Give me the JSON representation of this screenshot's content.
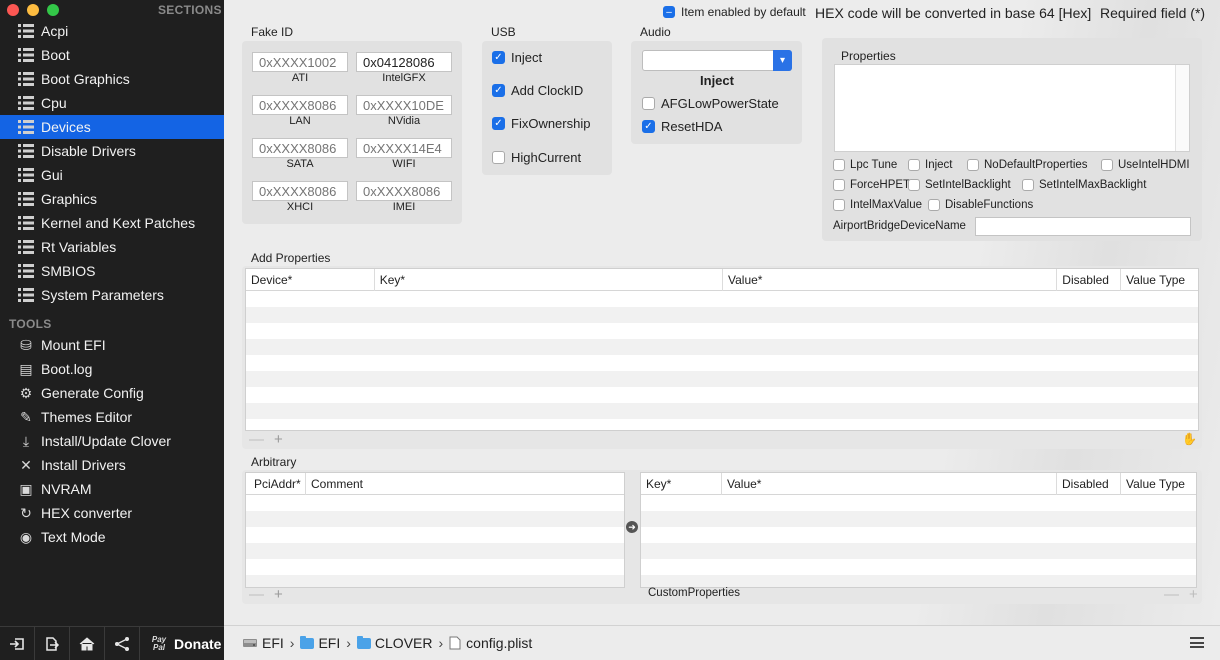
{
  "window": {
    "traffic_colors": [
      "#fc5753",
      "#fdbc40",
      "#33c748"
    ]
  },
  "sidebar": {
    "sections_heading": "SECTIONS",
    "sections": [
      {
        "label": "Acpi",
        "icon": "list-grid-icon"
      },
      {
        "label": "Boot",
        "icon": "list-grid-icon"
      },
      {
        "label": "Boot Graphics",
        "icon": "list-grid-icon"
      },
      {
        "label": "Cpu",
        "icon": "list-grid-icon"
      },
      {
        "label": "Devices",
        "icon": "list-grid-icon",
        "selected": true
      },
      {
        "label": "Disable Drivers",
        "icon": "list-grid-icon"
      },
      {
        "label": "Gui",
        "icon": "list-grid-icon"
      },
      {
        "label": "Graphics",
        "icon": "list-grid-icon"
      },
      {
        "label": "Kernel and Kext Patches",
        "icon": "list-grid-icon"
      },
      {
        "label": "Rt Variables",
        "icon": "list-grid-icon"
      },
      {
        "label": "SMBIOS",
        "icon": "list-grid-icon"
      },
      {
        "label": "System Parameters",
        "icon": "list-grid-icon"
      }
    ],
    "tools_heading": "TOOLS",
    "tools": [
      {
        "label": "Mount EFI",
        "icon": "disk-icon"
      },
      {
        "label": "Boot.log",
        "icon": "document-icon"
      },
      {
        "label": "Generate Config",
        "icon": "gear-icon"
      },
      {
        "label": "Themes Editor",
        "icon": "paint-icon"
      },
      {
        "label": "Install/Update Clover",
        "icon": "download-icon"
      },
      {
        "label": "Install Drivers",
        "icon": "wrench-icon"
      },
      {
        "label": "NVRAM",
        "icon": "chip-icon"
      },
      {
        "label": "HEX converter",
        "icon": "refresh-icon"
      },
      {
        "label": "Text Mode",
        "icon": "eye-icon"
      }
    ],
    "footer": {
      "paypal": "Pay Pal",
      "donate": "Donate"
    },
    "selected_color": "#1464e4"
  },
  "header": {
    "item_enabled_label": "Item enabled by default",
    "hex_note": "HEX code will be converted in base 64 [Hex]",
    "required_note": "Required field (*)"
  },
  "fake_id": {
    "title": "Fake ID",
    "fields": [
      {
        "label": "ATI",
        "placeholder": "0xXXXX1002",
        "value": ""
      },
      {
        "label": "IntelGFX",
        "placeholder": "",
        "value": "0x04128086"
      },
      {
        "label": "LAN",
        "placeholder": "0xXXXX8086",
        "value": ""
      },
      {
        "label": "NVidia",
        "placeholder": "0xXXXX10DE",
        "value": ""
      },
      {
        "label": "SATA",
        "placeholder": "0xXXXX8086",
        "value": ""
      },
      {
        "label": "WIFI",
        "placeholder": "0xXXXX14E4",
        "value": ""
      },
      {
        "label": "XHCI",
        "placeholder": "0xXXXX8086",
        "value": ""
      },
      {
        "label": "IMEI",
        "placeholder": "0xXXXX8086",
        "value": ""
      }
    ]
  },
  "usb": {
    "title": "USB",
    "options": [
      {
        "label": "Inject",
        "checked": true
      },
      {
        "label": "Add ClockID",
        "checked": true
      },
      {
        "label": "FixOwnership",
        "checked": true
      },
      {
        "label": "HighCurrent",
        "checked": false
      }
    ]
  },
  "audio": {
    "title": "Audio",
    "select_value": "",
    "inject_label": "Inject",
    "options": [
      {
        "label": "AFGLowPowerState",
        "checked": false
      },
      {
        "label": "ResetHDA",
        "checked": true
      }
    ]
  },
  "properties": {
    "title": "Properties",
    "checkboxes": [
      {
        "label": "Lpc Tune",
        "checked": false
      },
      {
        "label": "Inject",
        "checked": false
      },
      {
        "label": "NoDefaultProperties",
        "checked": false
      },
      {
        "label": "UseIntelHDMI",
        "checked": false
      },
      {
        "label": "ForceHPET",
        "checked": false
      },
      {
        "label": "SetIntelBacklight",
        "checked": false
      },
      {
        "label": "SetIntelMaxBacklight",
        "checked": false
      },
      {
        "label": "IntelMaxValue",
        "checked": false
      },
      {
        "label": "DisableFunctions",
        "checked": false
      }
    ],
    "airport_label": "AirportBridgeDeviceName",
    "airport_value": ""
  },
  "add_properties": {
    "title": "Add Properties",
    "columns": [
      "Device*",
      "Key*",
      "Value*",
      "Disabled",
      "Value Type"
    ]
  },
  "arbitrary": {
    "title": "Arbitrary",
    "left_columns": [
      "PciAddr*",
      "Comment"
    ],
    "right_columns": [
      "Key*",
      "Value*",
      "Disabled",
      "Value Type"
    ],
    "custom_properties_label": "CustomProperties"
  },
  "pathbar": {
    "crumbs": [
      "EFI",
      "EFI",
      "CLOVER",
      "config.plist"
    ]
  },
  "buttons": {
    "minus": "—",
    "plus": "+"
  }
}
